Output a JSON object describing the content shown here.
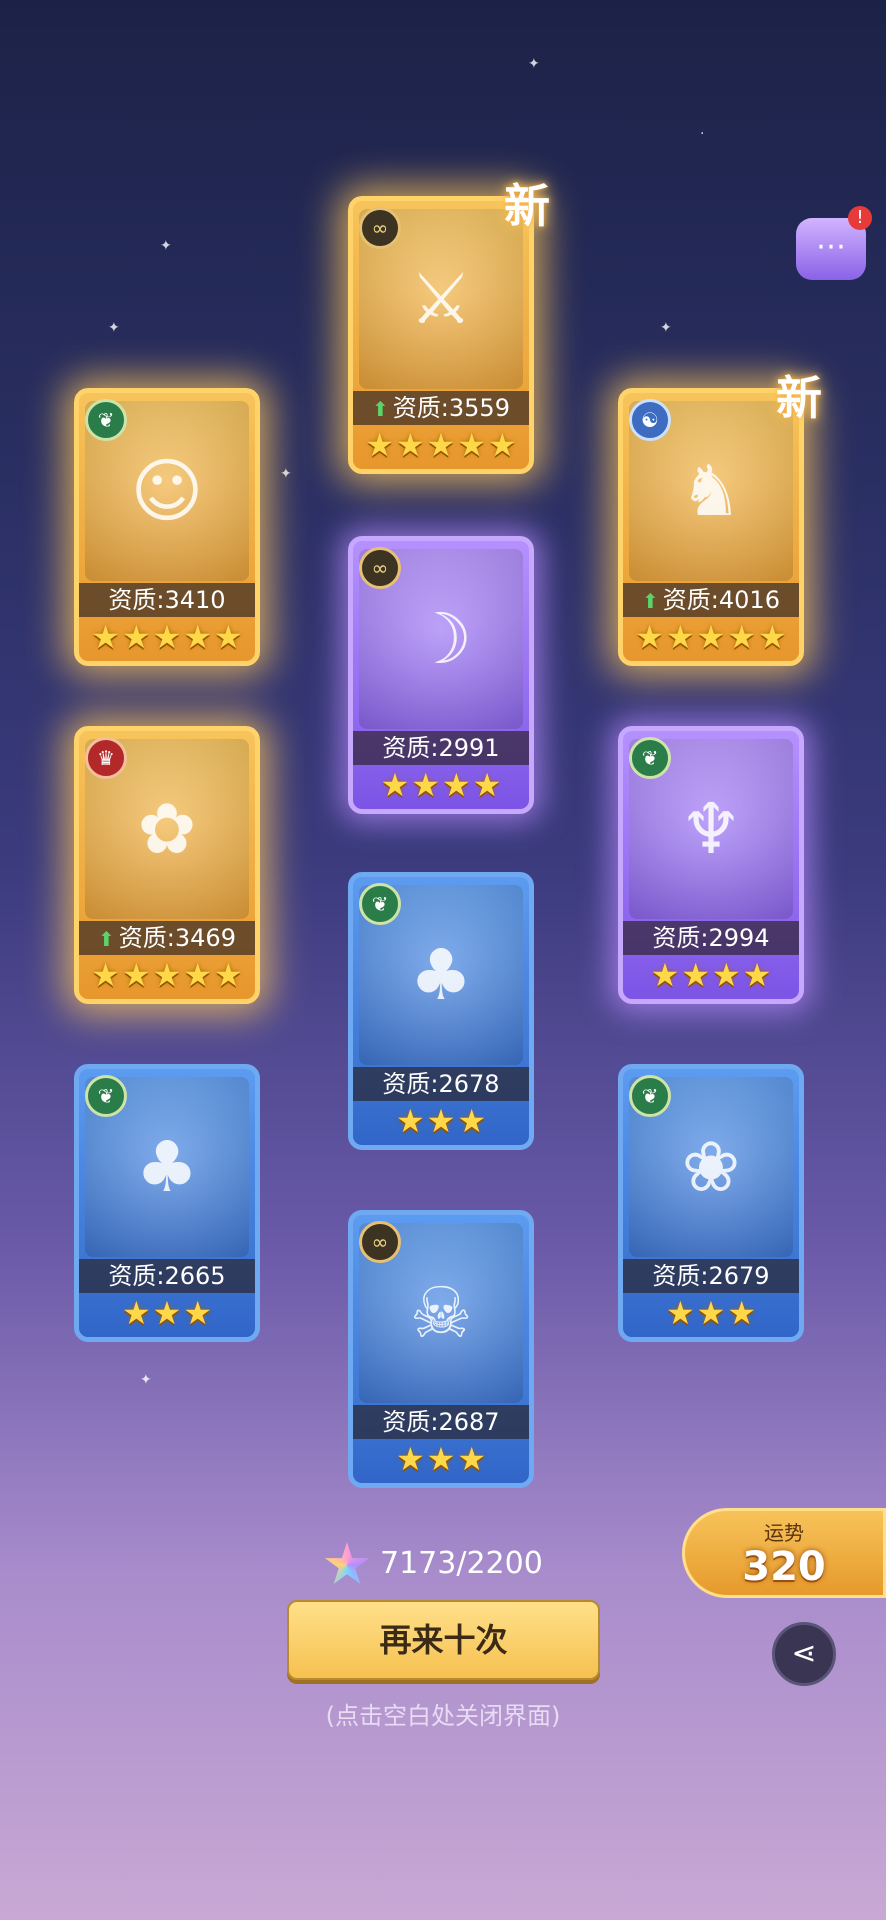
{
  "cards": [
    {
      "id": "c1",
      "rarity": "gold",
      "badge": "leaf",
      "stat": "资质:3410",
      "upgraded": false,
      "stars": 5,
      "new": false
    },
    {
      "id": "c2",
      "rarity": "gold",
      "badge": "ring",
      "stat": "资质:3559",
      "upgraded": true,
      "stars": 5,
      "new": true
    },
    {
      "id": "c3",
      "rarity": "gold",
      "badge": "dragon",
      "stat": "资质:4016",
      "upgraded": true,
      "stars": 5,
      "new": true
    },
    {
      "id": "c4",
      "rarity": "purple",
      "badge": "ring",
      "stat": "资质:2991",
      "upgraded": false,
      "stars": 4,
      "new": false
    },
    {
      "id": "c5",
      "rarity": "gold",
      "badge": "devil",
      "stat": "资质:3469",
      "upgraded": true,
      "stars": 5,
      "new": false
    },
    {
      "id": "c6",
      "rarity": "purple",
      "badge": "leaf",
      "stat": "资质:2994",
      "upgraded": false,
      "stars": 4,
      "new": false
    },
    {
      "id": "c7",
      "rarity": "blue",
      "badge": "leaf",
      "stat": "资质:2678",
      "upgraded": false,
      "stars": 3,
      "new": false
    },
    {
      "id": "c8",
      "rarity": "blue",
      "badge": "leaf",
      "stat": "资质:2665",
      "upgraded": false,
      "stars": 3,
      "new": false
    },
    {
      "id": "c9",
      "rarity": "blue",
      "badge": "leaf",
      "stat": "资质:2679",
      "upgraded": false,
      "stars": 3,
      "new": false
    },
    {
      "id": "c10",
      "rarity": "blue",
      "badge": "ring",
      "stat": "资质:2687",
      "upgraded": false,
      "stars": 3,
      "new": false
    }
  ],
  "new_label": "新",
  "luck": {
    "label": "运势",
    "value": "320"
  },
  "cost": {
    "text": "7173/2200"
  },
  "again_button": "再来十次",
  "hint": "(点击空白处关闭界面)",
  "icons": {
    "chat": "chat-bubble-icon",
    "share": "share-icon",
    "gem": "gem-icon",
    "star": "star-icon"
  }
}
